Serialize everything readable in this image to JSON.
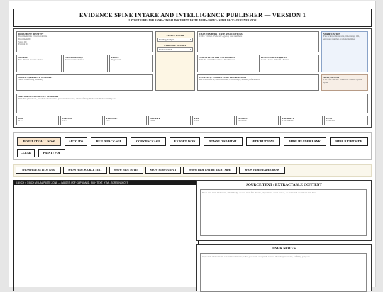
{
  "header": {
    "title": "EVIDENCE SPINE INTAKE AND INTELLIGENCE PUBLISHER — VERSION 1",
    "subtitle": "LAYOUT #1 HEADER BANK • VISUAL DOCUMENT PASTE ZONE • NOTES • SPINE PACKAGE GENERATOR"
  },
  "fields": {
    "doc_identity": {
      "label": "DOCUMENT IDENTITY",
      "lines": [
        "Document title / functional title",
        "Document ID",
        "Spine ID",
        "Exhibit ID"
      ]
    },
    "status_tower": {
      "label": "STATUS TOWER",
      "value": "Pending Analysis"
    },
    "evidence_weight": {
      "label": "EVIDENCE WEIGHT",
      "value": "Undetermined"
    },
    "case_numbers": {
      "label": "CASE NUMBERS / CASE ASSOCIATIONS",
      "placeholder": "CDC / Circuit / Federal / Agency case numbers"
    },
    "verification": {
      "label": "VERIFICATION",
      "placeholder": "Fax ticket, efile receipt, timestamp, QR, envelope number, tracking number"
    },
    "source": {
      "label": "SOURCE",
      "placeholder": "Fax / Email / Court / Portal"
    },
    "transmission": {
      "label": "TRANSMISSION",
      "placeholder": "Sent / received / filed"
    },
    "pages": {
      "label": "PAGES",
      "placeholder": "Page count"
    },
    "statutory": {
      "label": "TOP 3 STATUTORY CATEGORIES",
      "placeholder": "VRLTA / Civil Procedure / Due Process"
    },
    "responsible": {
      "label": "RESPONSIBLE PARTIES",
      "placeholder": "Court / Clerk / Sheriff / Parties"
    },
    "narrative": {
      "label": "SMALL NARRATIVE SUMMARY",
      "placeholder": "Short case-facing summary"
    },
    "conflict": {
      "label": "CONFLICT / CLOSED LOOP INFORMATION",
      "placeholder": "Record conflicts, contradictions, closed loops, missing information"
    },
    "next_action": {
      "label": "NEXT ACTION",
      "placeholder": "File / fax / serve / preserve / attach / update spine"
    },
    "master_summary": {
      "label": "MASTER INTELLIGENCE SUMMARY",
      "placeholder": "Timeline placement, jurisdiction relevance, preservation value, related filings, Federal/CDC/Circuit impact"
    },
    "small_row": [
      {
        "label": "GDC",
        "placeholder": "GV..."
      },
      {
        "label": "CIRCUIT",
        "placeholder": "CL..."
      },
      {
        "label": "FEDERAL",
        "placeholder": "3:..."
      },
      {
        "label": "SHERIFF",
        "placeholder": "SHR"
      },
      {
        "label": "FAX",
        "placeholder": "FAX"
      },
      {
        "label": "NOTICE",
        "placeholder": "NOTICE"
      },
      {
        "label": "PRESERVE",
        "placeholder": "PRESERVE"
      },
      {
        "label": "LINK",
        "placeholder": "LINKED"
      }
    ]
  },
  "actions": {
    "populate": "POPULATE ALL NOW",
    "auto_ids": "AUTO IDS",
    "build": "BUILD PACKAGE",
    "copy": "COPY PACKAGE",
    "export_json": "EXPORT JSON",
    "download_html": "DOWNLOAD HTML",
    "hide_buttons": "HIDE BUTTONS",
    "hide_header_bank": "HIDE HEADER BANK",
    "hide_right_side": "HIDE RIGHT SIDE",
    "clear": "CLEAR",
    "print": "PRINT / PDF"
  },
  "toggles": [
    "SHOW HIDE BUTTON BAR",
    "SHOW HIDE SOURCE TEXT",
    "SHOW HIDE NOTES",
    "SHOW HIDE OUTPUT",
    "SHOW HIDE ENTIRE RIGHT SIDE",
    "SHOW HIDE HEADER BANK"
  ],
  "visual_zone": {
    "header": "8.5INCH × 7 INCH VISUAL PASTE ZONE — IMAGES, PDF CLIPBOARD, RICH TEXT, HTML, SCREENSHOTS"
  },
  "source_text": {
    "title": "SOURCE TEXT / EXTRACTABLE CONTENT",
    "placeholder": "Paste raw text, OCR text, email body, docket text, file details, objections, court notice, or extracted document text here."
  },
  "user_notes": {
    "title": "USER NOTES",
    "placeholder": "Optional: add context, what this relates to, what you want analyzed, related thread/spine notes, or filing purpose."
  }
}
